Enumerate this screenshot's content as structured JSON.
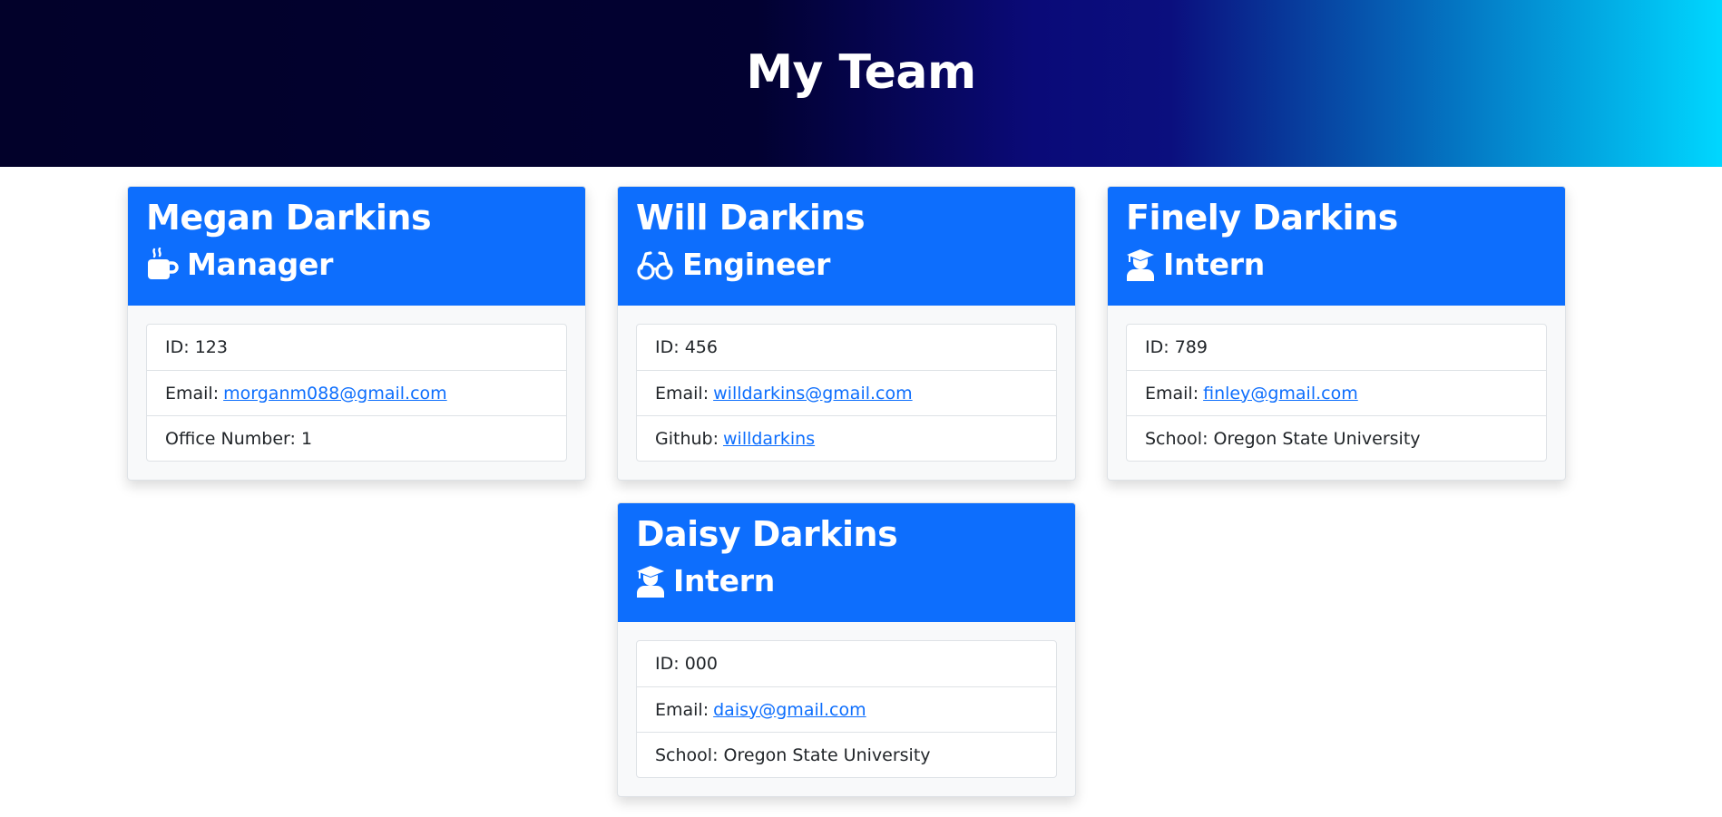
{
  "header": {
    "title": "My Team"
  },
  "colors": {
    "header_gradient_start": "#02012a",
    "header_gradient_mid": "#0a0a78",
    "header_gradient_end": "#00d7ff",
    "card_header": "#0d6efd",
    "link": "#0d6efd"
  },
  "team": [
    {
      "name": "Megan Darkins",
      "role": "Manager",
      "icon": "mug-hot-icon",
      "id_label": "ID:",
      "id_value": "123",
      "email_label": "Email:",
      "email": "morganm088@gmail.com",
      "extra_label": "Office Number:",
      "extra_value": "1"
    },
    {
      "name": "Will Darkins",
      "role": "Engineer",
      "icon": "glasses-icon",
      "id_label": "ID:",
      "id_value": "456",
      "email_label": "Email:",
      "email": "willdarkins@gmail.com",
      "extra_label": "Github:",
      "extra_value": "willdarkins"
    },
    {
      "name": "Finely Darkins",
      "role": "Intern",
      "icon": "user-graduate-icon",
      "id_label": "ID:",
      "id_value": "789",
      "email_label": "Email:",
      "email": "finley@gmail.com",
      "extra_label": "School:",
      "extra_value": "Oregon State University"
    },
    {
      "name": "Daisy Darkins",
      "role": "Intern",
      "icon": "user-graduate-icon",
      "id_label": "ID:",
      "id_value": "000",
      "email_label": "Email:",
      "email": "daisy@gmail.com",
      "extra_label": "School:",
      "extra_value": "Oregon State University"
    }
  ]
}
